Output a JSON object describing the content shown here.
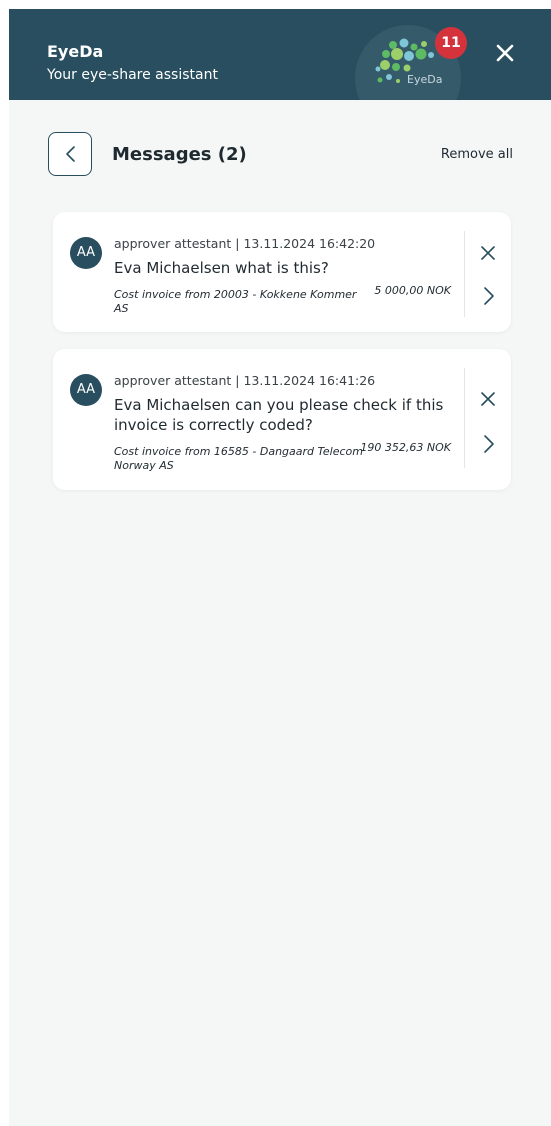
{
  "header": {
    "title": "EyeDa",
    "subtitle": "Your eye-share assistant",
    "logo_text": "EyeDa",
    "badge_count": "11",
    "icons": {
      "close": "close-icon",
      "logo": "eyeda-logo-icon"
    },
    "colors": {
      "background": "#284e5f",
      "badge": "#d5333c"
    }
  },
  "messages_panel": {
    "title": "Messages (2)",
    "remove_all_label": "Remove all",
    "icons": {
      "back": "chevron-left-icon"
    }
  },
  "messages": [
    {
      "avatar_initials": "AA",
      "meta": "approver attestant | 13.11.2024 16:42:20",
      "text": "Eva Michaelsen what is this?",
      "invoice_ref": "Cost invoice from 20003 - Kokkene Kommer AS",
      "amount": "5 000,00 NOK"
    },
    {
      "avatar_initials": "AA",
      "meta": "approver attestant | 13.11.2024 16:41:26",
      "text": "Eva Michaelsen can you please check if this invoice is correctly coded?",
      "invoice_ref": "Cost invoice from 16585 - Dangaard Telecom Norway AS",
      "amount": "190 352,63 NOK"
    }
  ],
  "theme": {
    "accent": "#284e5f",
    "panel_background": "#f5f6f6",
    "card_background": "#ffffff"
  }
}
